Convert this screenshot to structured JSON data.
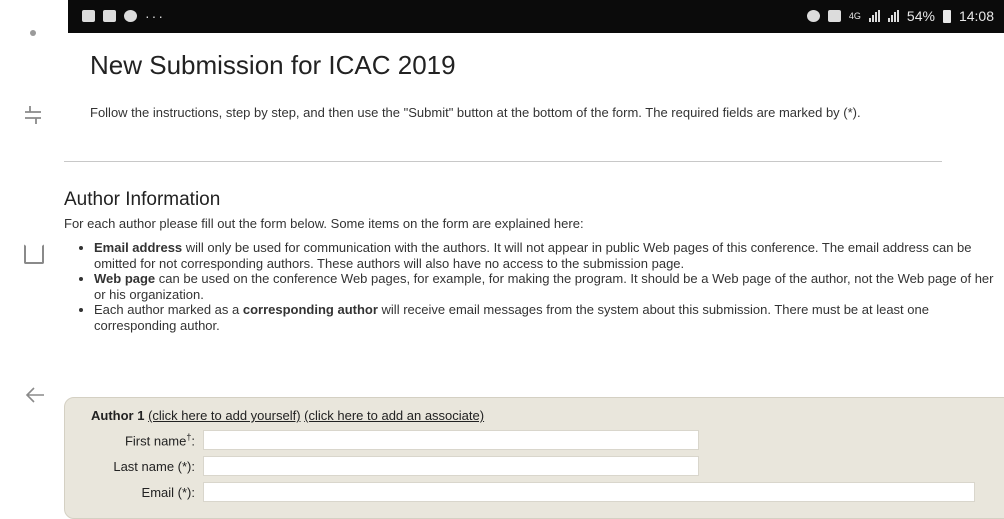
{
  "status_bar": {
    "battery": "54%",
    "time": "14:08",
    "network": "4G",
    "more": "···"
  },
  "page": {
    "title": "New Submission for ICAC 2019",
    "instructions": "Follow the instructions, step by step, and then use the \"Submit\" button at the bottom of the form. The required fields are marked by (*)."
  },
  "author_information": {
    "heading": "Author Information",
    "intro": "For each author please fill out the form below. Some items on the form are explained here:",
    "bullets": [
      {
        "bold": "Email address",
        "text": " will only be used for communication with the authors. It will not appear in public Web pages of this conference. The email address can be omitted for not corresponding authors. These authors will also have no access to the submission page."
      },
      {
        "bold": "Web page",
        "text": " can be used on the conference Web pages, for example, for making the program. It should be a Web page of the author, not the Web page of her or his organization."
      },
      {
        "prefix": "Each author marked as a ",
        "bold": "corresponding author",
        "text": " will receive email messages from the system about this submission. There must be at least one corresponding author."
      }
    ]
  },
  "author_form": {
    "title": "Author 1",
    "add_yourself": "(click here to add yourself)",
    "add_associate": "(click here to add an associate)",
    "fields": {
      "first_name_label": "First name",
      "first_name_mark": "†",
      "first_name_value": "",
      "last_name_label": "Last name (*):",
      "last_name_value": "",
      "email_label": "Email (*):",
      "email_value": ""
    }
  }
}
